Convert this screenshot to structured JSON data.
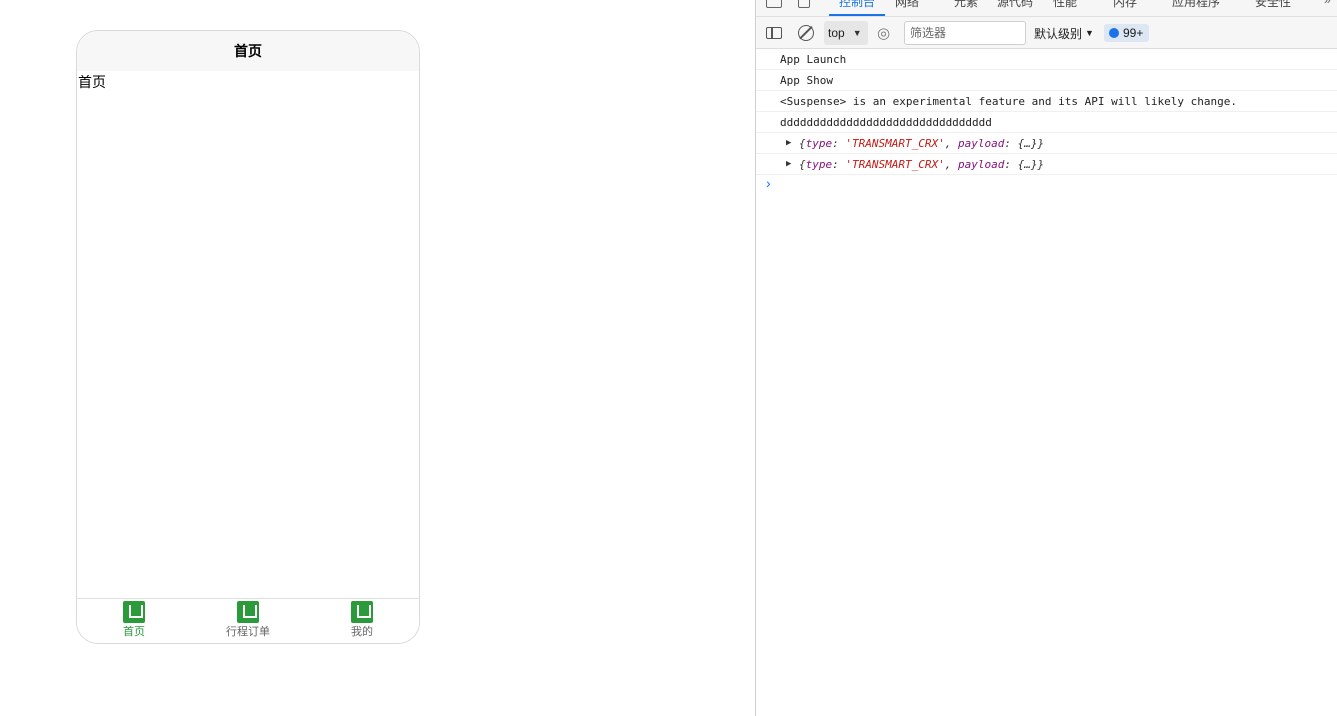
{
  "phone": {
    "nav_title": "首页",
    "page_text": "首页",
    "tabs": [
      {
        "label": "首页",
        "active": true,
        "icon": "uni-app-icon"
      },
      {
        "label": "行程订单",
        "active": false,
        "icon": "uni-app-icon"
      },
      {
        "label": "我的",
        "active": false,
        "icon": "uni-app-icon"
      }
    ],
    "accent_color": "#2a9a3a"
  },
  "devtools": {
    "tabs": [
      "控制台",
      "网络",
      "元素",
      "源代码",
      "性能",
      "内存",
      "应用程序",
      "安全性"
    ],
    "active_tab": "控制台",
    "toolbar": {
      "context": "top",
      "filter_placeholder": "筛选器",
      "level": "默认级别",
      "issues_count": "99+"
    },
    "console_lines": [
      "App Launch",
      "App Show",
      "<Suspense> is an experimental feature and its API will likely change.",
      "dddddddddddddddddddddddddddddddd"
    ],
    "console_objects": [
      {
        "type_key": "type",
        "type_value": "'TRANSMART_CRX'",
        "payload_key": "payload",
        "payload_value": "{…}"
      },
      {
        "type_key": "type",
        "type_value": "'TRANSMART_CRX'",
        "payload_key": "payload",
        "payload_value": "{…}"
      }
    ],
    "prompt_symbol": "›"
  }
}
